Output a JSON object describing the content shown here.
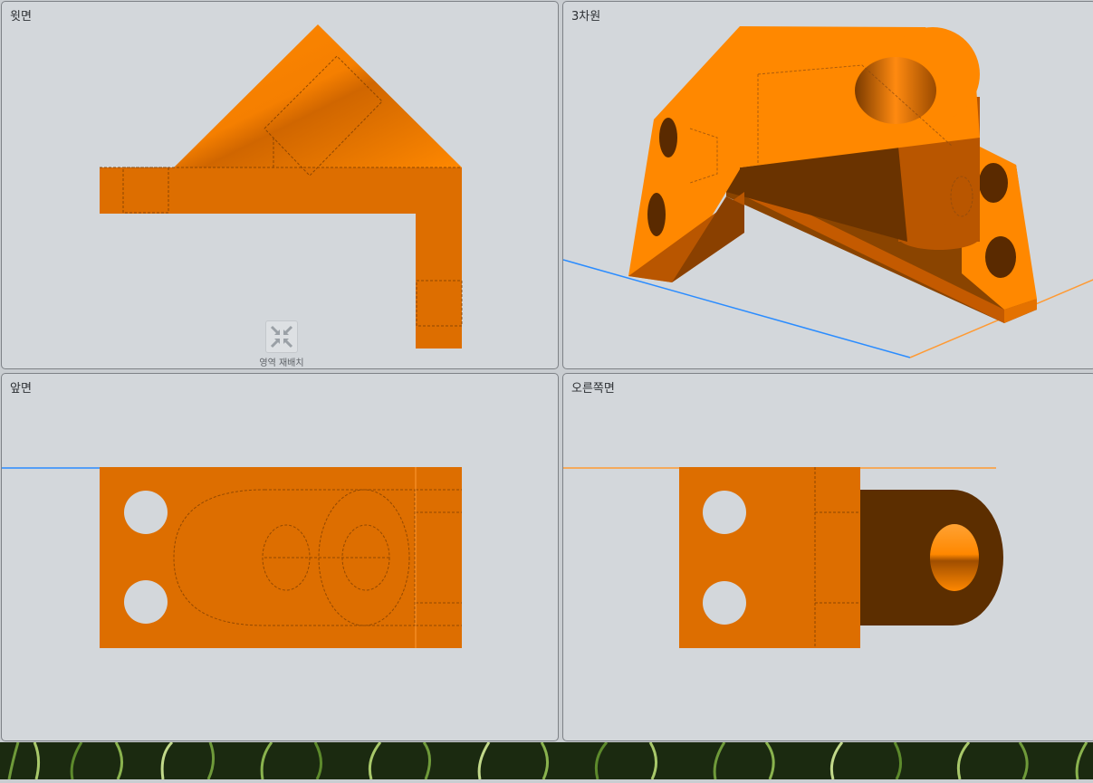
{
  "viewports": {
    "top": {
      "title": "윗면"
    },
    "three_d": {
      "title": "3차원"
    },
    "front": {
      "title": "앞면"
    },
    "right": {
      "title": "오른쪽면"
    }
  },
  "controls": {
    "rearrange_label": "영역 재배치",
    "rearrange_icon": "collapse-arrows-icon"
  },
  "colors": {
    "part_orange": "#ff8800",
    "part_face_mid": "#dd6e00",
    "part_face_dark": "#5c2e00",
    "viewport_bg": "#d3d7db",
    "axis_blue": "#2a8cff",
    "axis_orange": "#ff9a33"
  }
}
